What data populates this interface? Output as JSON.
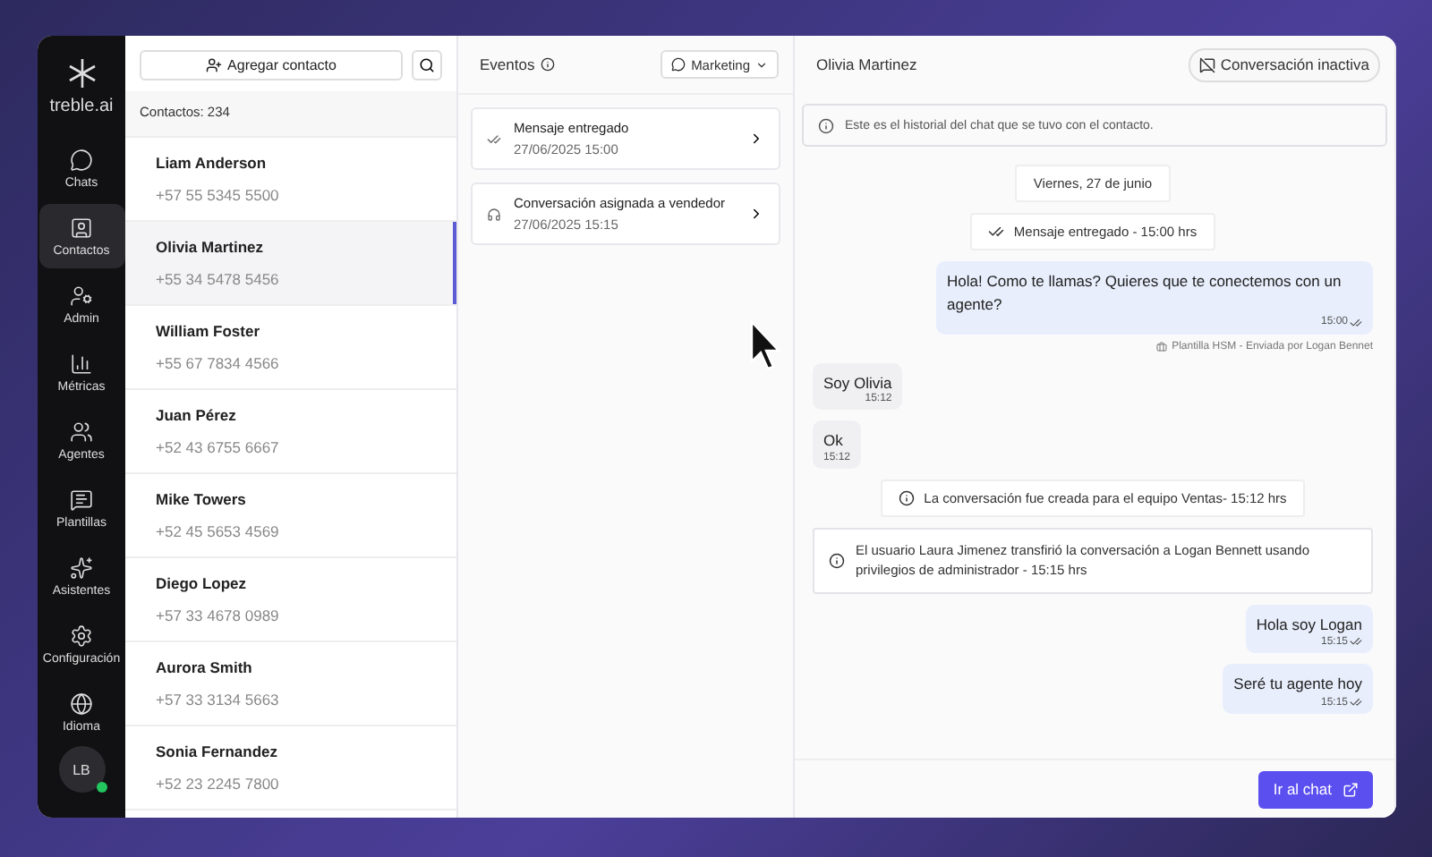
{
  "sidebar": {
    "logo": "treble.ai",
    "items": [
      {
        "label": "Chats",
        "selected": false
      },
      {
        "label": "Contactos",
        "selected": true
      },
      {
        "label": "Admin",
        "selected": false
      },
      {
        "label": "Métricas",
        "selected": false
      },
      {
        "label": "Agentes",
        "selected": false
      },
      {
        "label": "Plantillas",
        "selected": false
      },
      {
        "label": "Asistentes",
        "selected": false
      },
      {
        "label": "Configuración",
        "selected": false
      },
      {
        "label": "Idioma",
        "selected": false
      }
    ],
    "avatar": {
      "initials": "LB",
      "online": true
    }
  },
  "contacts": {
    "add_button": "Agregar contacto",
    "count": "Contactos: 234",
    "items": [
      {
        "name": "Liam Anderson",
        "phone": "+57 55 5345 5500",
        "selected": false
      },
      {
        "name": "Olivia Martinez",
        "phone": "+55 34 5478 5456",
        "selected": true
      },
      {
        "name": "William Foster",
        "phone": "+55 67 7834 4566",
        "selected": false
      },
      {
        "name": "Juan Pérez",
        "phone": "+52 43 6755 6667",
        "selected": false
      },
      {
        "name": "Mike Towers",
        "phone": "+52 45 5653 4569",
        "selected": false
      },
      {
        "name": "Diego Lopez",
        "phone": "+57 33 4678 0989",
        "selected": false
      },
      {
        "name": "Aurora Smith",
        "phone": "+57 33 3134 5663",
        "selected": false
      },
      {
        "name": "Sonia Fernandez",
        "phone": "+52 23 2245 7800",
        "selected": false
      }
    ]
  },
  "events": {
    "title": "Eventos",
    "channel": "Marketing",
    "items": [
      {
        "kind": "delivered",
        "title": "Mensaje entregado",
        "date": "27/06/2025 15:00"
      },
      {
        "kind": "assigned",
        "title": "Conversación asignada a vendedor",
        "date": "27/06/2025 15:15"
      }
    ]
  },
  "chat": {
    "contact": "Olivia Martinez",
    "status": "Conversación inactiva",
    "notice": "Este es el historial del chat que se tuvo con el contacto.",
    "messages": [
      {
        "kind": "date",
        "text": "Viernes, 27 de junio"
      },
      {
        "kind": "status",
        "text": "Mensaje entregado - 15:00 hrs"
      },
      {
        "kind": "outgoing",
        "text": "Hola! Como te llamas? Quieres que te conectemos con un agente?",
        "time": "15:00",
        "footer": "Plantilla HSM  - Enviada por Logan Bennet"
      },
      {
        "kind": "incoming",
        "text": "Soy Olivia",
        "time": "15:12"
      },
      {
        "kind": "incoming",
        "text": "Ok",
        "time": "15:12"
      },
      {
        "kind": "system",
        "text": "La conversación fue creada para el equipo Ventas- 15:12 hrs"
      },
      {
        "kind": "system_wide",
        "text": "El usuario Laura Jimenez transfirió la conversación a Logan Bennett usando privilegios de administrador - 15:15 hrs"
      },
      {
        "kind": "outgoing",
        "text": "Hola soy Logan",
        "time": "15:15"
      },
      {
        "kind": "outgoing",
        "text": "Seré tu agente hoy",
        "time": "15:15"
      }
    ],
    "action": "Ir al chat"
  }
}
